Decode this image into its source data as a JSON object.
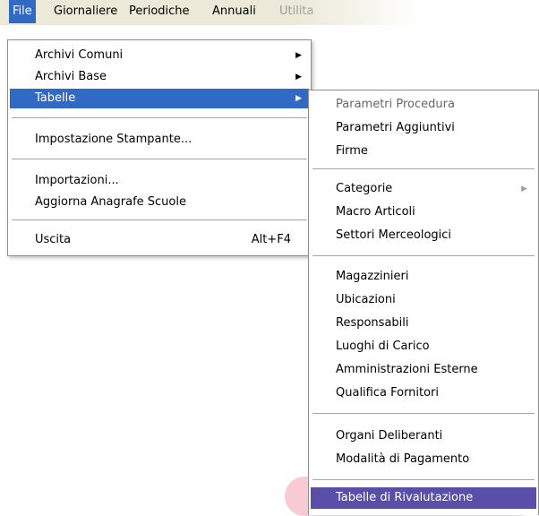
{
  "menubar": {
    "items": [
      "File",
      "Giornaliere",
      "Periodiche",
      "Annuali",
      "Utilita"
    ]
  },
  "file_menu": {
    "archivi_comuni": "Archivi Comuni",
    "archivi_base": "Archivi Base",
    "tabelle": "Tabelle",
    "impostazione_stampante": "Impostazione Stampante...",
    "importazioni": "Importazioni...",
    "aggiorna_anagrafe": "Aggiorna Anagrafe Scuole",
    "uscita": "Uscita",
    "uscita_shortcut": "Alt+F4"
  },
  "tabelle_menu": {
    "items": [
      "Parametri Procedura",
      "Parametri Aggiuntivi",
      "Firme",
      "Categorie",
      "Macro Articoli",
      "Settori Merceologici",
      "Magazzinieri",
      "Ubicazioni",
      "Responsabili",
      "Luoghi di Carico",
      "Amministrazioni Esterne",
      "Qualifica Fornitori",
      "Organi Deliberanti",
      "Modalità di Pagamento",
      "Tabelle di Rivalutazione"
    ]
  },
  "icons": {
    "submenu_arrow": "submenu-arrow-icon"
  },
  "colors": {
    "menubar_bg": "#ece9d8",
    "selection": "#316ac5",
    "last_selection": "#5a4fa8",
    "highlight_glow": "#f08ca0"
  }
}
